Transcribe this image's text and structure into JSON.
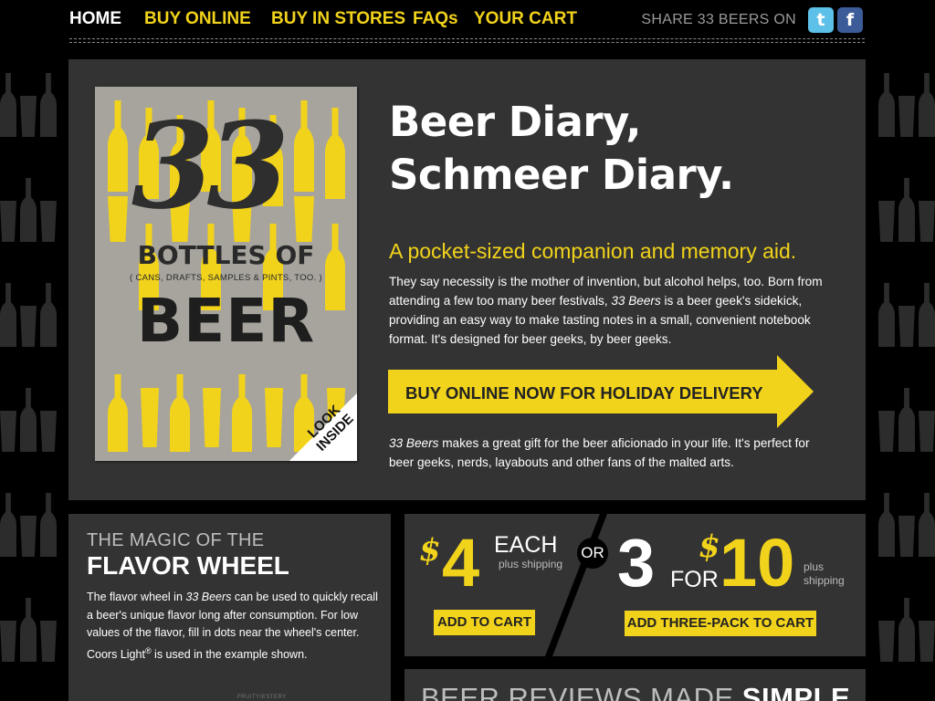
{
  "colors": {
    "accent": "#f2d31b",
    "panel": "#333333",
    "background": "#000000",
    "cover": "#a7a49d"
  },
  "nav": {
    "home": "HOME",
    "buy_online": "BUY ONLINE",
    "buy_in_stores": "BUY IN STORES",
    "faqs": "FAQs",
    "your_cart": "YOUR CART",
    "share": "SHARE 33 BEERS ON",
    "twitter_icon": "twitter-icon",
    "facebook_icon": "facebook-icon"
  },
  "book": {
    "number": "33",
    "bottles_of": "BOTTLES OF",
    "subtitle": "( CANS, DRAFTS, SAMPLES & PINTS, TOO. )",
    "beer": "BEER",
    "look_inside": "LOOK INSIDE"
  },
  "hero": {
    "title_line1": "Beer Diary,",
    "title_line2": "Schmeer Diary.",
    "subtitle": "A pocket-sized companion and memory aid.",
    "body_1": "They say necessity is the mother of invention, but alcohol helps, too. Born from attending a few too many beer festivals, ",
    "body_em": "33 Beers",
    "body_2": " is a beer geek's sidekick, providing an easy way to make tasting notes in a small, convenient notebook format. It's designed for beer geeks, by beer geeks.",
    "cta": "BUY ONLINE NOW FOR HOLIDAY DELIVERY",
    "gift_em": "33 Beers",
    "gift_rest": " makes a great gift for the beer aficionado in your life. It's perfect for beer geeks, nerds, layabouts and other fans of the malted arts."
  },
  "flavor": {
    "kicker": "THE MAGIC OF THE",
    "title": "FLAVOR WHEEL",
    "body_1": "The flavor wheel in ",
    "body_em": "33 Beers",
    "body_2": " can be used to quickly recall a beer's unique flavor long after consumption. For low values of the flavor, fill in dots near the wheel's center. Coors Light",
    "body_sup": "®",
    "body_3": " is used in the example shown.",
    "wheel_label": "FRUITY/ESTERY"
  },
  "pricing": {
    "dollar": "$",
    "single_price": "4",
    "each": "EACH",
    "single_shipping": "plus shipping",
    "or": "OR",
    "pack_qty": "3",
    "for": "FOR",
    "pack_price": "10",
    "pack_shipping_1": "plus",
    "pack_shipping_2": "shipping",
    "add_to_cart": "ADD TO CART",
    "add_three_pack": "ADD THREE-PACK TO CART"
  },
  "reviews": {
    "title_light": "BEER REVIEWS MADE ",
    "title_bold": "SIMPLE"
  }
}
